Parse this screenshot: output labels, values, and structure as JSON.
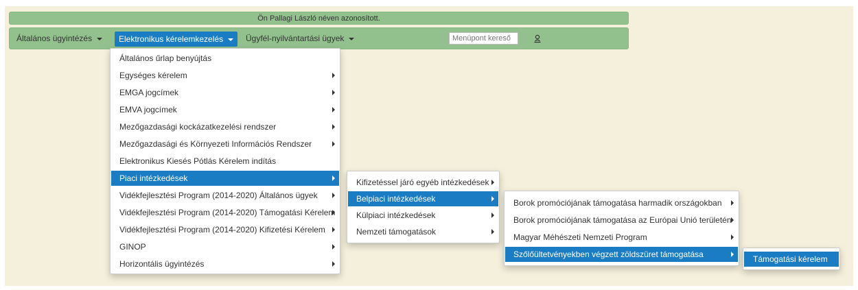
{
  "auth_banner": "Ön Pallagi László néven azonosított.",
  "nav": {
    "items": [
      {
        "label": "Általános ügyintézés"
      },
      {
        "label": "Elektronikus kérelemkezelés"
      },
      {
        "label": "Ügyfél-nyilvántartási ügyek"
      }
    ],
    "search_placeholder": "Menüpont kereső"
  },
  "menu1": {
    "items": [
      {
        "label": "Általános űrlap benyújtás"
      },
      {
        "label": "Egységes kérelem"
      },
      {
        "label": "EMGA jogcímek"
      },
      {
        "label": "EMVA jogcímek"
      },
      {
        "label": "Mezőgazdasági kockázatkezelési rendszer"
      },
      {
        "label": "Mezőgazdasági és Környezeti Információs Rendszer"
      },
      {
        "label": "Elektronikus Kiesés Pótlás Kérelem indítás"
      },
      {
        "label": "Piaci intézkedések"
      },
      {
        "label": "Vidékfejlesztési Program (2014-2020) Általános ügyek"
      },
      {
        "label": "Vidékfejlesztési Program (2014-2020) Támogatási Kérelem"
      },
      {
        "label": "Vidékfejlesztési Program (2014-2020) Kifizetési Kérelem"
      },
      {
        "label": "GINOP"
      },
      {
        "label": "Horizontális ügyintézés"
      }
    ]
  },
  "menu2": {
    "items": [
      {
        "label": "Kifizetéssel járó egyéb intézkedések"
      },
      {
        "label": "Belpiaci intézkedések"
      },
      {
        "label": "Külpiaci intézkedések"
      },
      {
        "label": "Nemzeti támogatások"
      }
    ]
  },
  "menu3": {
    "items": [
      {
        "label": "Borok promóciójának támogatása harmadik országokban"
      },
      {
        "label": "Borok promóciójának támogatása az Európai Unió területén"
      },
      {
        "label": "Magyar Méhészeti Nemzeti Program"
      },
      {
        "label": "Szőlőültetvényekben végzett zöldszüret támogatása"
      }
    ]
  },
  "menu4": {
    "items": [
      {
        "label": "Támogatási kérelem"
      }
    ]
  },
  "colors": {
    "background": "#f5f0dc",
    "nav_green": "#93c18e",
    "highlight_blue": "#1a7cc2"
  }
}
